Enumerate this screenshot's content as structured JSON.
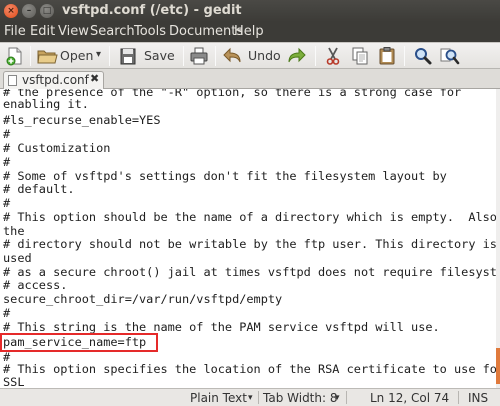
{
  "window": {
    "title": "vsftpd.conf (/etc) - gedit",
    "close_glyph": "×",
    "min_glyph": "–",
    "max_glyph": "□"
  },
  "menu": [
    "File",
    "Edit",
    "View",
    "Search",
    "Tools",
    "Documents",
    "Help"
  ],
  "toolbar": {
    "open_label": "Open",
    "open_dropdown": "▾",
    "save_label": "Save",
    "undo_label": "Undo"
  },
  "tab": {
    "label": "vsftpd.conf",
    "close_glyph": "✖"
  },
  "editor": {
    "lines": [
      "# the presence of the \"-R\" option, so there is a strong case for",
      "enabling it.",
      "#ls_recurse_enable=YES",
      "#",
      "# Customization",
      "#",
      "# Some of vsftpd's settings don't fit the filesystem layout by",
      "# default.",
      "#",
      "# This option should be the name of a directory which is empty.  Also,",
      "the",
      "# directory should not be writable by the ftp user. This directory is",
      "used",
      "# as a secure chroot() jail at times vsftpd does not require filesystem",
      "# access.",
      "secure_chroot_dir=/var/run/vsftpd/empty",
      "#",
      "# This string is the name of the PAM service vsftpd will use.",
      "pam_service_name=ftp",
      "#",
      "# This option specifies the location of the RSA certificate to use for",
      "SSL"
    ]
  },
  "statusbar": {
    "language": "Plain Text",
    "tab_width": "Tab Width: 8",
    "position": "Ln 12, Col 74",
    "mode": "INS",
    "dropdown_glyph": "▾"
  },
  "colors": {
    "highlight_border": "#e52a2a",
    "close_button": "#df4a16",
    "scroll_marker": "#e07a3c"
  }
}
